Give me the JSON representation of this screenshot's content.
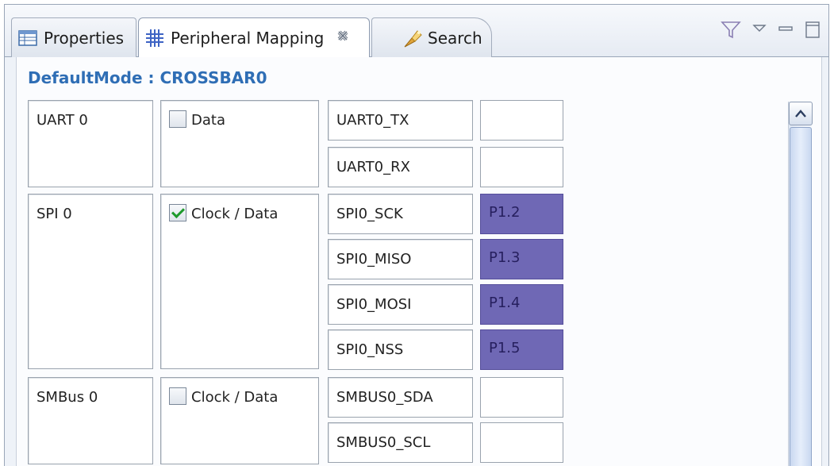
{
  "tabs": [
    {
      "label": "Properties",
      "icon": "properties-table-icon"
    },
    {
      "label": "Peripheral Mapping",
      "icon": "grid-mapping-icon",
      "close_icon": "close-icon"
    },
    {
      "label": "Search",
      "icon": "search-flashlight-icon"
    }
  ],
  "view_toolbar": [
    "filter-icon",
    "view-menu-icon",
    "minimize-icon",
    "maximize-icon"
  ],
  "content": {
    "title": "DefaultMode : CROSSBAR0"
  },
  "peripherals": [
    {
      "name": "UART 0",
      "option": {
        "label": "Data",
        "checked": false
      },
      "signals": [
        {
          "name": "UART0_TX",
          "pin": ""
        },
        {
          "name": "UART0_RX",
          "pin": ""
        }
      ]
    },
    {
      "name": "SPI 0",
      "option": {
        "label": "Clock / Data",
        "checked": true
      },
      "signals": [
        {
          "name": "SPI0_SCK",
          "pin": "P1.2"
        },
        {
          "name": "SPI0_MISO",
          "pin": "P1.3"
        },
        {
          "name": "SPI0_MOSI",
          "pin": "P1.4"
        },
        {
          "name": "SPI0_NSS",
          "pin": "P1.5"
        }
      ]
    },
    {
      "name": "SMBus 0",
      "option": {
        "label": "Clock / Data",
        "checked": false
      },
      "signals": [
        {
          "name": "SMBUS0_SDA",
          "pin": ""
        },
        {
          "name": "SMBUS0_SCL",
          "pin": ""
        }
      ]
    }
  ],
  "colors": {
    "assigned_pin": "#6f68b5",
    "title_blue": "#2f6eb5"
  }
}
